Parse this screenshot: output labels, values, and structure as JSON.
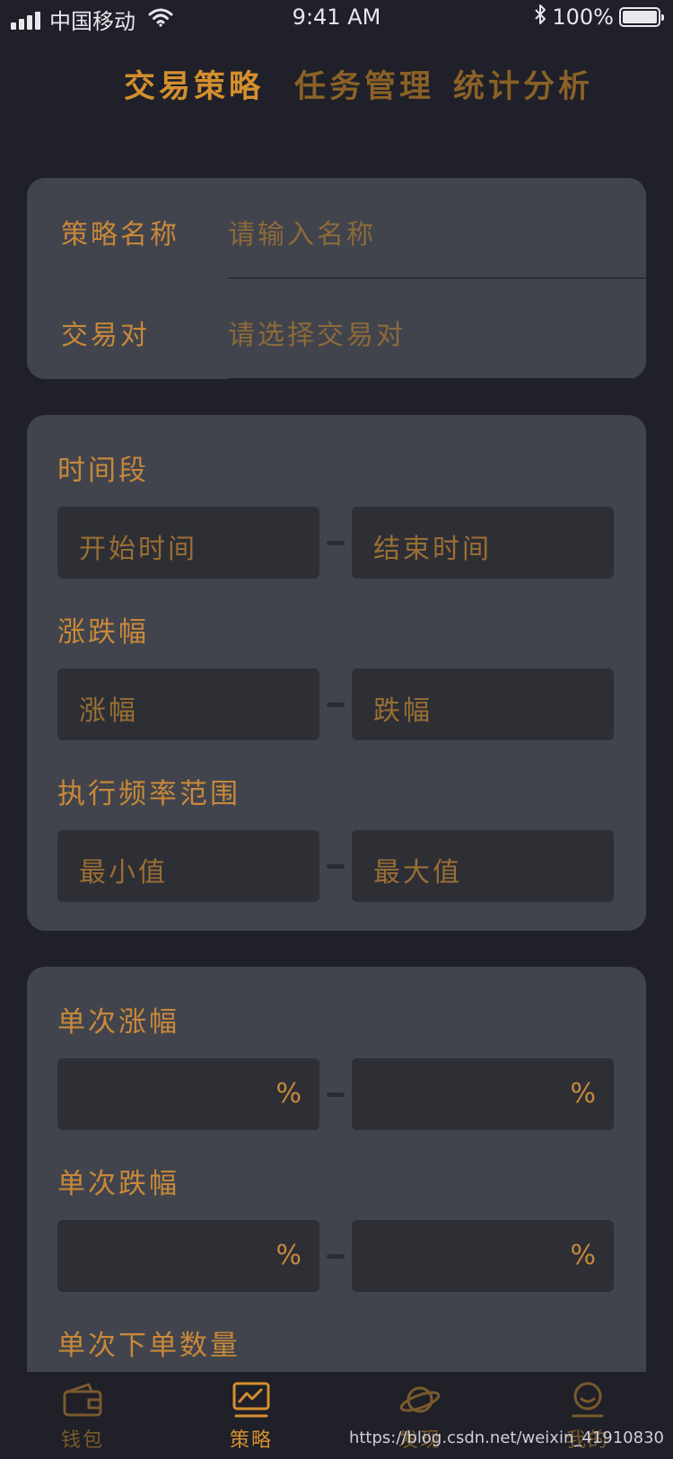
{
  "status": {
    "carrier": "中国移动",
    "time": "9:41 AM",
    "battery": "100%"
  },
  "tabs": [
    {
      "label": "交易策略",
      "active": true
    },
    {
      "label": "任务管理",
      "active": false
    },
    {
      "label": "统计分析",
      "active": false
    }
  ],
  "basic": {
    "name_label": "策略名称",
    "name_placeholder": "请输入名称",
    "pair_label": "交易对",
    "pair_placeholder": "请选择交易对"
  },
  "ranges": {
    "time_label": "时间段",
    "time_start": "开始时间",
    "time_end": "结束时间",
    "change_label": "涨跌幅",
    "rise": "涨幅",
    "fall": "跌幅",
    "freq_label": "执行频率范围",
    "min": "最小值",
    "max": "最大值"
  },
  "single": {
    "rise_label": "单次涨幅",
    "fall_label": "单次跌幅",
    "qty_label": "单次下单数量",
    "percent": "%"
  },
  "bottom_nav": [
    {
      "label": "钱包",
      "icon": "wallet-icon",
      "active": false
    },
    {
      "label": "策略",
      "icon": "chart-icon",
      "active": true
    },
    {
      "label": "发现",
      "icon": "planet-icon",
      "active": false
    },
    {
      "label": "我的",
      "icon": "user-icon",
      "active": false
    }
  ],
  "watermark": "https://blog.csdn.net/weixin_41910830",
  "colors": {
    "background": "#1f2029",
    "card": "#41444c",
    "input": "#2d2f35",
    "accent": "#d48f2e"
  }
}
